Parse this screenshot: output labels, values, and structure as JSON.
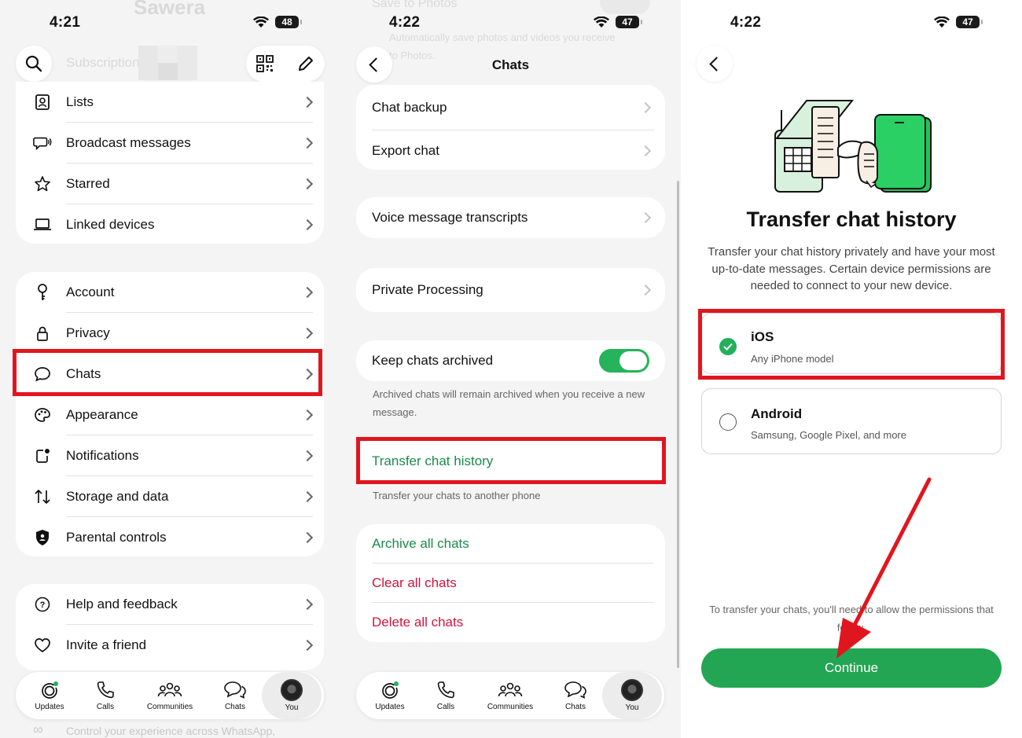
{
  "colors": {
    "accent_green": "#22a653",
    "link_green": "#1a8b4b",
    "danger_red": "#d0143e",
    "highlight_red": "#e0161f",
    "background": "#f4f4f4"
  },
  "screen1": {
    "time": "4:21",
    "battery": "48",
    "ghost_profile_name": "Sawera",
    "ghost_subscription": "Subscription",
    "group1": [
      {
        "label": "Lists",
        "icon": "contact-list-icon"
      },
      {
        "label": "Broadcast messages",
        "icon": "broadcast-icon"
      },
      {
        "label": "Starred",
        "icon": "star-icon"
      },
      {
        "label": "Linked devices",
        "icon": "laptop-icon"
      }
    ],
    "group2": [
      {
        "label": "Account",
        "icon": "key-icon"
      },
      {
        "label": "Privacy",
        "icon": "lock-icon"
      },
      {
        "label": "Chats",
        "icon": "chat-bubble-icon"
      },
      {
        "label": "Appearance",
        "icon": "palette-icon"
      },
      {
        "label": "Notifications",
        "icon": "notification-icon"
      },
      {
        "label": "Storage and data",
        "icon": "arrows-updown-icon"
      },
      {
        "label": "Parental controls",
        "icon": "shield-icon"
      }
    ],
    "group3": [
      {
        "label": "Help and feedback",
        "icon": "help-icon"
      },
      {
        "label": "Invite a friend",
        "icon": "heart-icon"
      }
    ],
    "ghost_footer": "Control your experience across WhatsApp,"
  },
  "screen2": {
    "time": "4:22",
    "battery": "47",
    "ghost_title": "Save to Photos",
    "ghost_text_1": "Automatically save photos and videos you receive",
    "ghost_text_2": "to Photos.",
    "title": "Chats",
    "chat_backup": "Chat backup",
    "export_chat": "Export chat",
    "voice_transcripts": "Voice message transcripts",
    "private_processing": "Private Processing",
    "keep_archived": "Keep chats archived",
    "keep_archived_on": true,
    "archived_note": "Archived chats will remain archived when you receive a new message.",
    "transfer_history": "Transfer chat history",
    "transfer_note": "Transfer your chats to another phone",
    "archive_all": "Archive all chats",
    "clear_all": "Clear all chats",
    "delete_all": "Delete all chats"
  },
  "tabs": [
    {
      "label": "Updates",
      "icon": "updates-icon"
    },
    {
      "label": "Calls",
      "icon": "phone-icon"
    },
    {
      "label": "Communities",
      "icon": "communities-icon"
    },
    {
      "label": "Chats",
      "icon": "chats-icon"
    },
    {
      "label": "You",
      "icon": "avatar"
    }
  ],
  "screen3": {
    "time": "4:22",
    "battery": "47",
    "heading": "Transfer chat history",
    "description": "Transfer your chat history privately and have your most up-to-date messages. Certain device permissions are needed to connect to your new device.",
    "option_ios_title": "iOS",
    "option_ios_sub": "Any iPhone model",
    "option_ios_selected": true,
    "option_android_title": "Android",
    "option_android_sub": "Samsung, Google Pixel, and more",
    "permissions_note": "To transfer your chats, you'll need to allow the permissions that follow.",
    "continue_label": "Continue"
  }
}
